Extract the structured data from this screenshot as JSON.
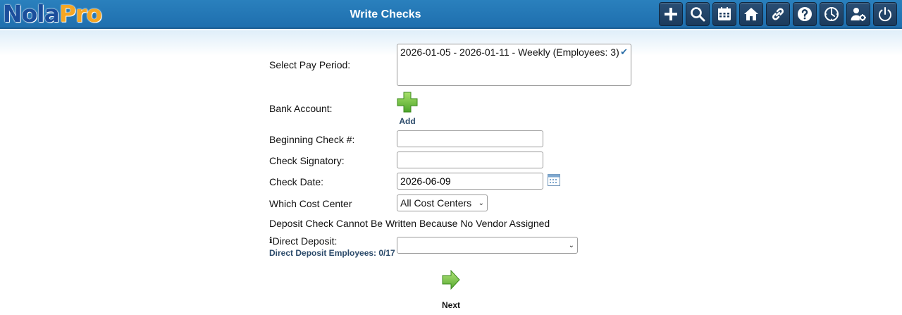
{
  "app": {
    "logo_part1": "Nola",
    "logo_part2": "Pro",
    "title": "Write Checks"
  },
  "toolbar": [
    "plus-icon",
    "search-icon",
    "calendar-icon",
    "home-icon",
    "link-icon",
    "help-icon",
    "clock-icon",
    "user-settings-icon",
    "power-icon"
  ],
  "form": {
    "pay_period_label": "Select Pay Period:",
    "pay_period_option": "2026-01-05 - 2026-01-11 - Weekly (Employees: 3)",
    "pay_period_check": "✔",
    "bank_account_label": "Bank Account:",
    "add_label": "Add",
    "beginning_check_label": "Beginning Check #:",
    "beginning_check_value": "",
    "check_signatory_label": "Check Signatory:",
    "check_signatory_value": "",
    "check_date_label": "Check Date:",
    "check_date_value": "2026-06-09",
    "cost_center_label": "Which Cost Center",
    "cost_center_selected": "All Cost Centers",
    "deposit_notice": "Deposit Check Cannot Be Written Because No Vendor Assigned",
    "direct_deposit_label": "Direct Deposit:",
    "direct_deposit_sub": "Direct Deposit Employees: 0/17",
    "direct_deposit_selected": "",
    "info_icon": "ℹ",
    "select_arrow": "⌄",
    "next_label": "Next"
  },
  "colors": {
    "header": "#1f6fae",
    "button": "#1b3a5c",
    "accent_green": "#6cc03a",
    "link": "#2b4a6a"
  }
}
